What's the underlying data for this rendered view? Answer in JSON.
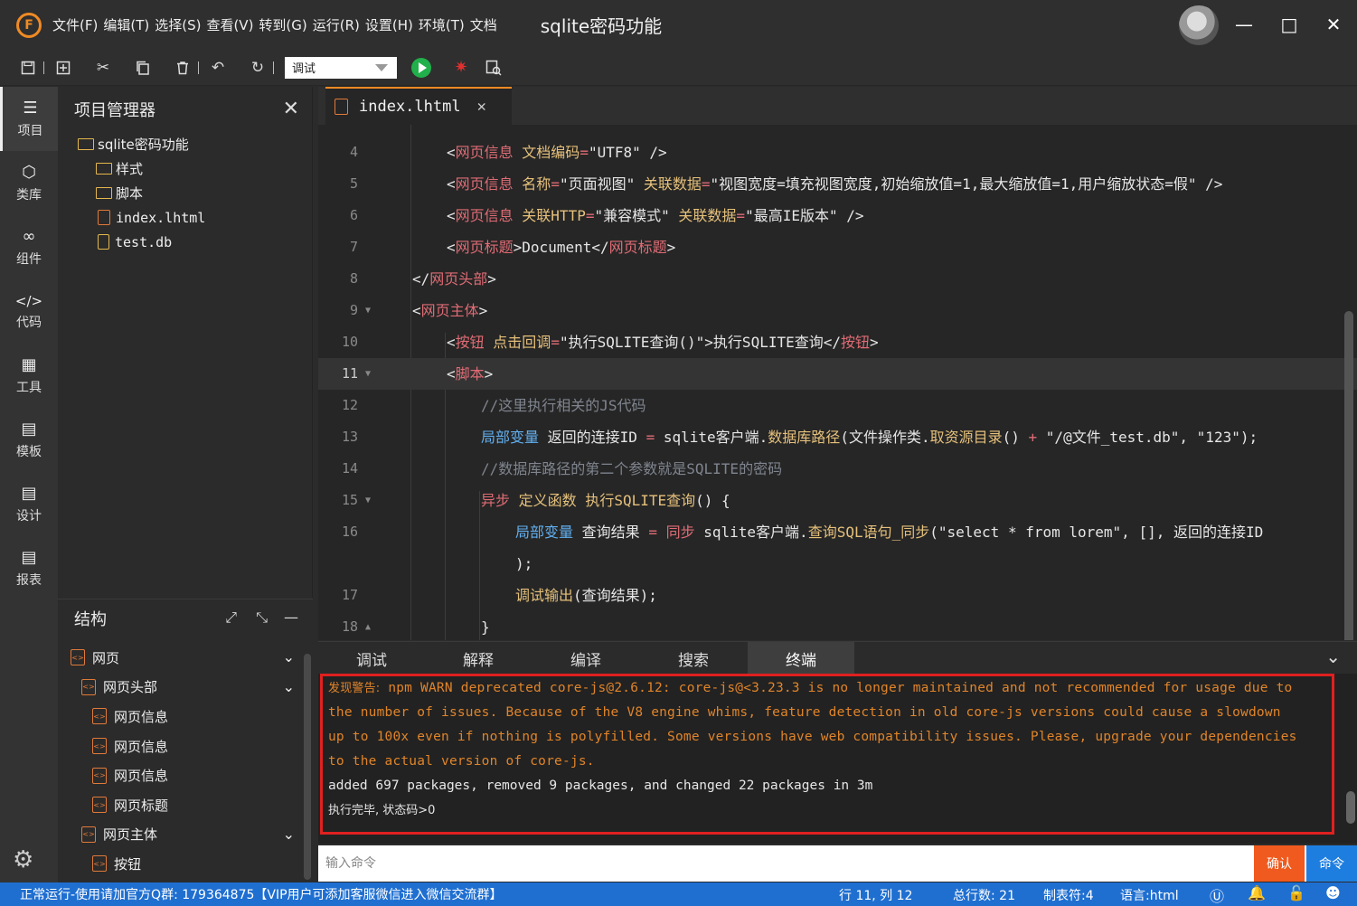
{
  "window": {
    "title": "sqlite密码功能",
    "menus": [
      "文件(F)",
      "编辑(T)",
      "选择(S)",
      "查看(V)",
      "转到(G)",
      "运行(R)",
      "设置(H)",
      "环境(T)",
      "文档"
    ]
  },
  "toolbar": {
    "mode_select": "调试"
  },
  "activity": [
    {
      "label": "项目",
      "icon": "layers-icon"
    },
    {
      "label": "类库",
      "icon": "cube-icon"
    },
    {
      "label": "组件",
      "icon": "link-icon"
    },
    {
      "label": "代码",
      "icon": "code-icon"
    },
    {
      "label": "工具",
      "icon": "grid-icon"
    },
    {
      "label": "模板",
      "icon": "template-icon"
    },
    {
      "label": "设计",
      "icon": "design-icon"
    },
    {
      "label": "报表",
      "icon": "report-icon"
    }
  ],
  "project": {
    "header": "项目管理器",
    "root": "sqlite密码功能",
    "items": [
      "样式",
      "脚本",
      "index.lhtml",
      "test.db"
    ]
  },
  "structure": {
    "header": "结构",
    "items": [
      "网页",
      "网页头部",
      "网页信息",
      "网页信息",
      "网页信息",
      "网页标题",
      "网页主体",
      "按钮"
    ]
  },
  "editor": {
    "tab": "index.lhtml",
    "line_numbers": [
      "4",
      "5",
      "6",
      "7",
      "8",
      "9",
      "10",
      "11",
      "12",
      "13",
      "14",
      "15",
      "16",
      "",
      "17",
      "18"
    ]
  },
  "bottom": {
    "tabs": [
      "调试",
      "解释",
      "编译",
      "搜索",
      "终端"
    ],
    "terminal": {
      "warn_label": "发现警告:",
      "warn_text_1": " npm WARN deprecated core-js@2.6.12: core-js@<3.23.3 is no longer maintained and not recommended for usage due to",
      "warn_text_2": "the number of issues. Because of the V8 engine whims, feature detection in old core-js versions could cause a slowdown",
      "warn_text_3": "up to 100x even if nothing is polyfilled. Some versions have web compatibility issues. Please, upgrade your dependencies",
      "warn_text_4": "to the actual version of core-js.",
      "added_line": "added 697 packages, removed 9 packages, and changed 22 packages in 3m",
      "done_line": "执行完毕, 状态码>0"
    },
    "command_placeholder": "输入命令",
    "confirm_label": "确认",
    "command_label": "命令"
  },
  "status": {
    "left": "正常运行-使用请加官方Q群: 179364875【VIP用户可添加客服微信进入微信交流群】",
    "position": "行 11, 列 12",
    "total_lines": "总行数: 21",
    "tab_size": "制表符:4",
    "language": "语言:html"
  },
  "colors": {
    "accent_orange": "#f08a24",
    "status_blue": "#1f6fd1",
    "warn_orange": "#e0842a",
    "highlight_red": "#e02020"
  }
}
